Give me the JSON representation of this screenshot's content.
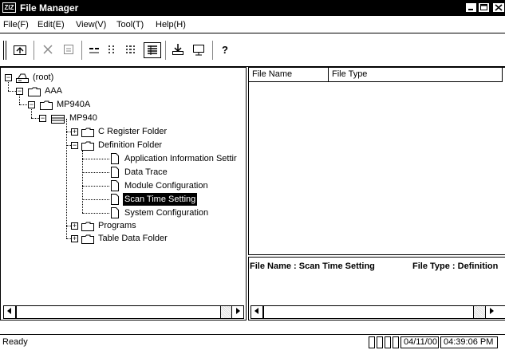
{
  "window": {
    "app_icon_text": "ZIZ",
    "title": "File Manager"
  },
  "menu": [
    "File(F)",
    "Edit(E)",
    "View(V)",
    "Tool(T)",
    "Help(H)"
  ],
  "toolbar": {
    "help_glyph": "?"
  },
  "tree": {
    "root": "(root)",
    "aaa": "AAA",
    "mp940a": "MP940A",
    "mp940": "MP940",
    "c_register": "C Register Folder",
    "definition": "Definition Folder",
    "app_info": "Application Information Settir",
    "data_trace": "Data Trace",
    "module_config": "Module Configuration",
    "scan_time": "Scan Time Setting",
    "system_config": "System Configuration",
    "programs": "Programs",
    "table_data": "Table Data Folder",
    "expand_plus": "+",
    "collapse_minus": "−"
  },
  "list": {
    "col_file_name": "File Name",
    "col_file_type": "File Type"
  },
  "details": {
    "file_name": "File Name : Scan Time Setting",
    "file_type": "File Type : Definition"
  },
  "status": {
    "text": "Ready",
    "date": "04/11/00",
    "time": "04:39:06 PM"
  }
}
